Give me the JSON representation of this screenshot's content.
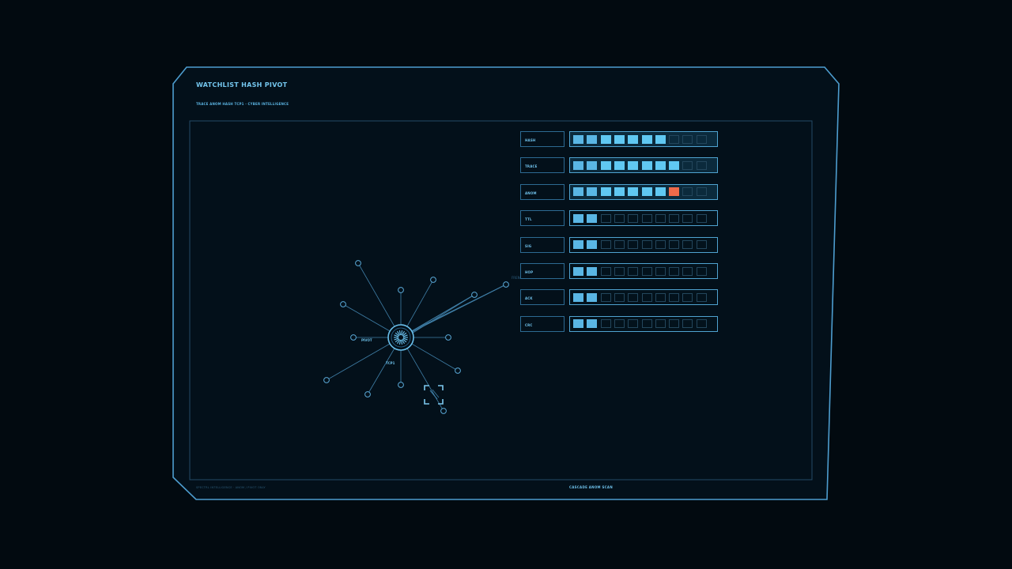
{
  "panel": {
    "title": "WATCHLIST HASH PIVOT",
    "subtitle": "TRACE ANOM HASH TCP1 · CYBER INTELLIGENCE",
    "footer_left": "SPECTRL INTELLIGENCE · ANOM / PIVOT ONLY",
    "footer_right": "CASCADE ANOM SCAN"
  },
  "graph": {
    "hub_label": "PIVOT",
    "hub_sub_label": "TCP1",
    "remote_label": "FRENCH",
    "spoke_count": 12,
    "target_icon": "target-reticle-icon"
  },
  "meters": [
    {
      "label": "HASH",
      "level": 7,
      "max": 10,
      "alert": null,
      "highlight": true
    },
    {
      "label": "TRACE",
      "level": 8,
      "max": 10,
      "alert": null,
      "highlight": true
    },
    {
      "label": "ANOM",
      "level": 7,
      "max": 10,
      "alert": 8,
      "highlight": true
    },
    {
      "label": "TTL",
      "level": 2,
      "max": 10,
      "alert": null,
      "highlight": false
    },
    {
      "label": "SIG",
      "level": 2,
      "max": 10,
      "alert": null,
      "highlight": false
    },
    {
      "label": "HOP",
      "level": 2,
      "max": 10,
      "alert": null,
      "highlight": false
    },
    {
      "label": "ACK",
      "level": 2,
      "max": 10,
      "alert": null,
      "highlight": false
    },
    {
      "label": "CRC",
      "level": 2,
      "max": 10,
      "alert": null,
      "highlight": false
    }
  ],
  "colors": {
    "background": "#020a10",
    "frame": "#4f9fd0",
    "accent": "#5ab6e4",
    "alert": "#ee6a4a"
  }
}
